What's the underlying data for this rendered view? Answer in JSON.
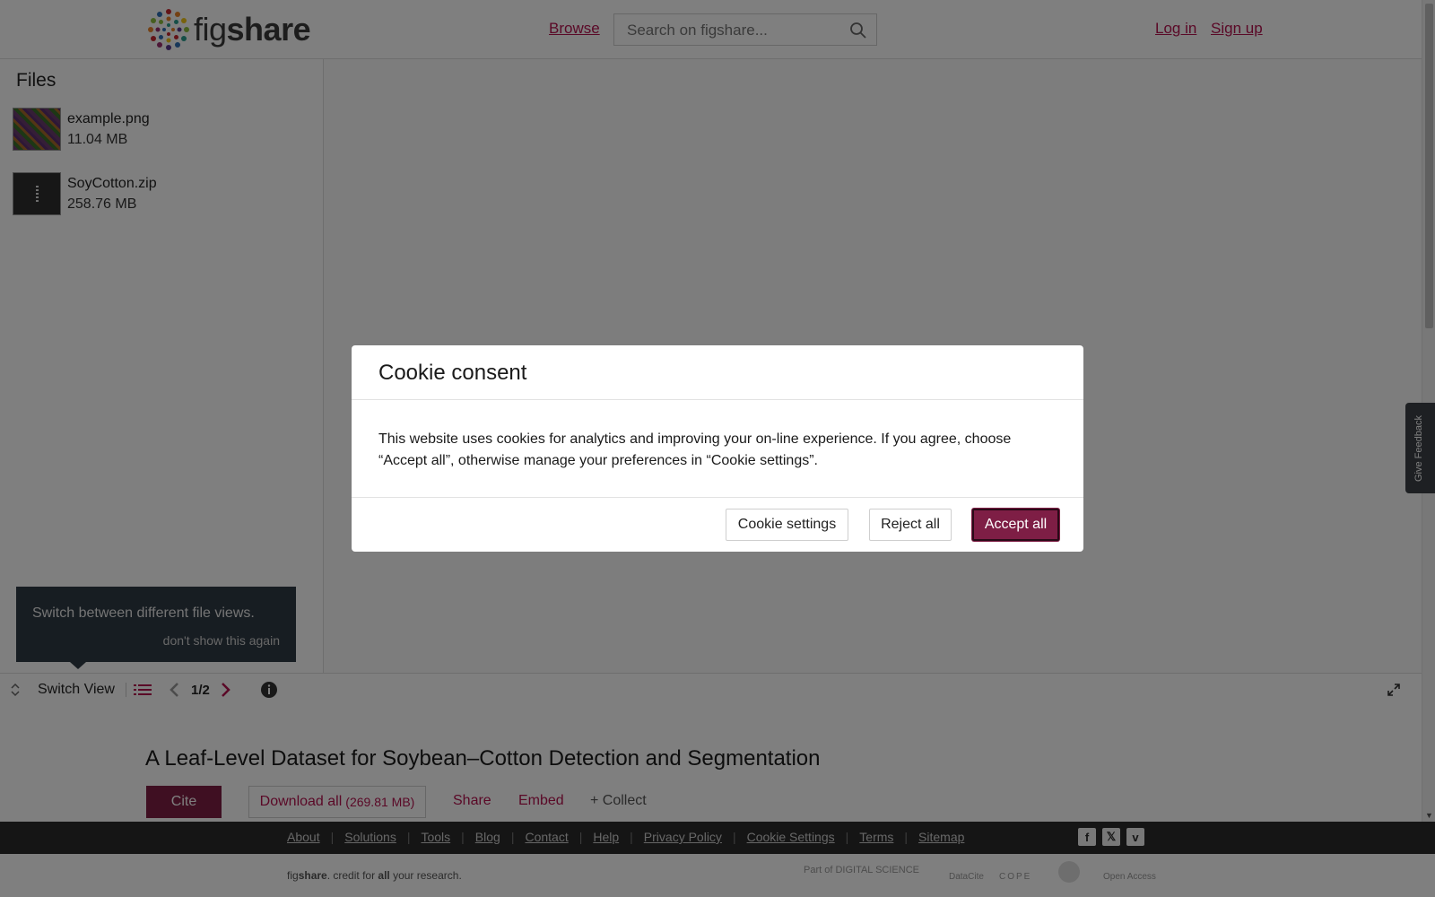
{
  "header": {
    "logo_text_light": "fig",
    "logo_text_bold": "share",
    "browse_label": "Browse",
    "search_placeholder": "Search on figshare...",
    "login_label": "Log in",
    "signup_label": "Sign up"
  },
  "files_panel": {
    "title": "Files",
    "files": [
      {
        "name": "example.png",
        "size": "11.04 MB"
      },
      {
        "name": "SoyCotton.zip",
        "size": "258.76 MB"
      }
    ]
  },
  "tooltip": {
    "text": "Switch between different file views.",
    "dismiss": "don't show this again"
  },
  "toolbar": {
    "switch_view_label": "Switch View",
    "page_indicator": "1/2"
  },
  "article": {
    "title": "A Leaf-Level Dataset for Soybean–Cotton Detection and Segmentation",
    "cite_label": "Cite",
    "download_label": "Download all",
    "download_size": "(269.81 MB)",
    "share_label": "Share",
    "embed_label": "Embed",
    "collect_label": "+ Collect"
  },
  "footer": {
    "links": [
      "About",
      "Solutions",
      "Tools",
      "Blog",
      "Contact",
      "Help",
      "Privacy Policy",
      "Cookie Settings",
      "Terms",
      "Sitemap"
    ],
    "tagline_prefix": "fig",
    "tagline_brand": "share",
    "tagline_mid": ". credit for ",
    "tagline_all": "all",
    "tagline_end": " your research.",
    "partners": [
      "Part of DIGITAL SCIENCE",
      "DataCite",
      "COPE",
      "Open Access"
    ],
    "social_icons": [
      "facebook-icon",
      "x-icon",
      "vimeo-icon"
    ]
  },
  "feedback": {
    "label": "Give Feedback"
  },
  "cookie_modal": {
    "title": "Cookie consent",
    "body": "This website uses cookies for analytics and improving your on-line experience. If you agree, choose “Accept all”, otherwise manage your preferences in “Cookie settings”.",
    "settings_label": "Cookie settings",
    "reject_label": "Reject all",
    "accept_label": "Accept all"
  },
  "colors": {
    "brand": "#7e1e45",
    "link": "#b5124e",
    "footer_bg": "#2a2a2a"
  }
}
